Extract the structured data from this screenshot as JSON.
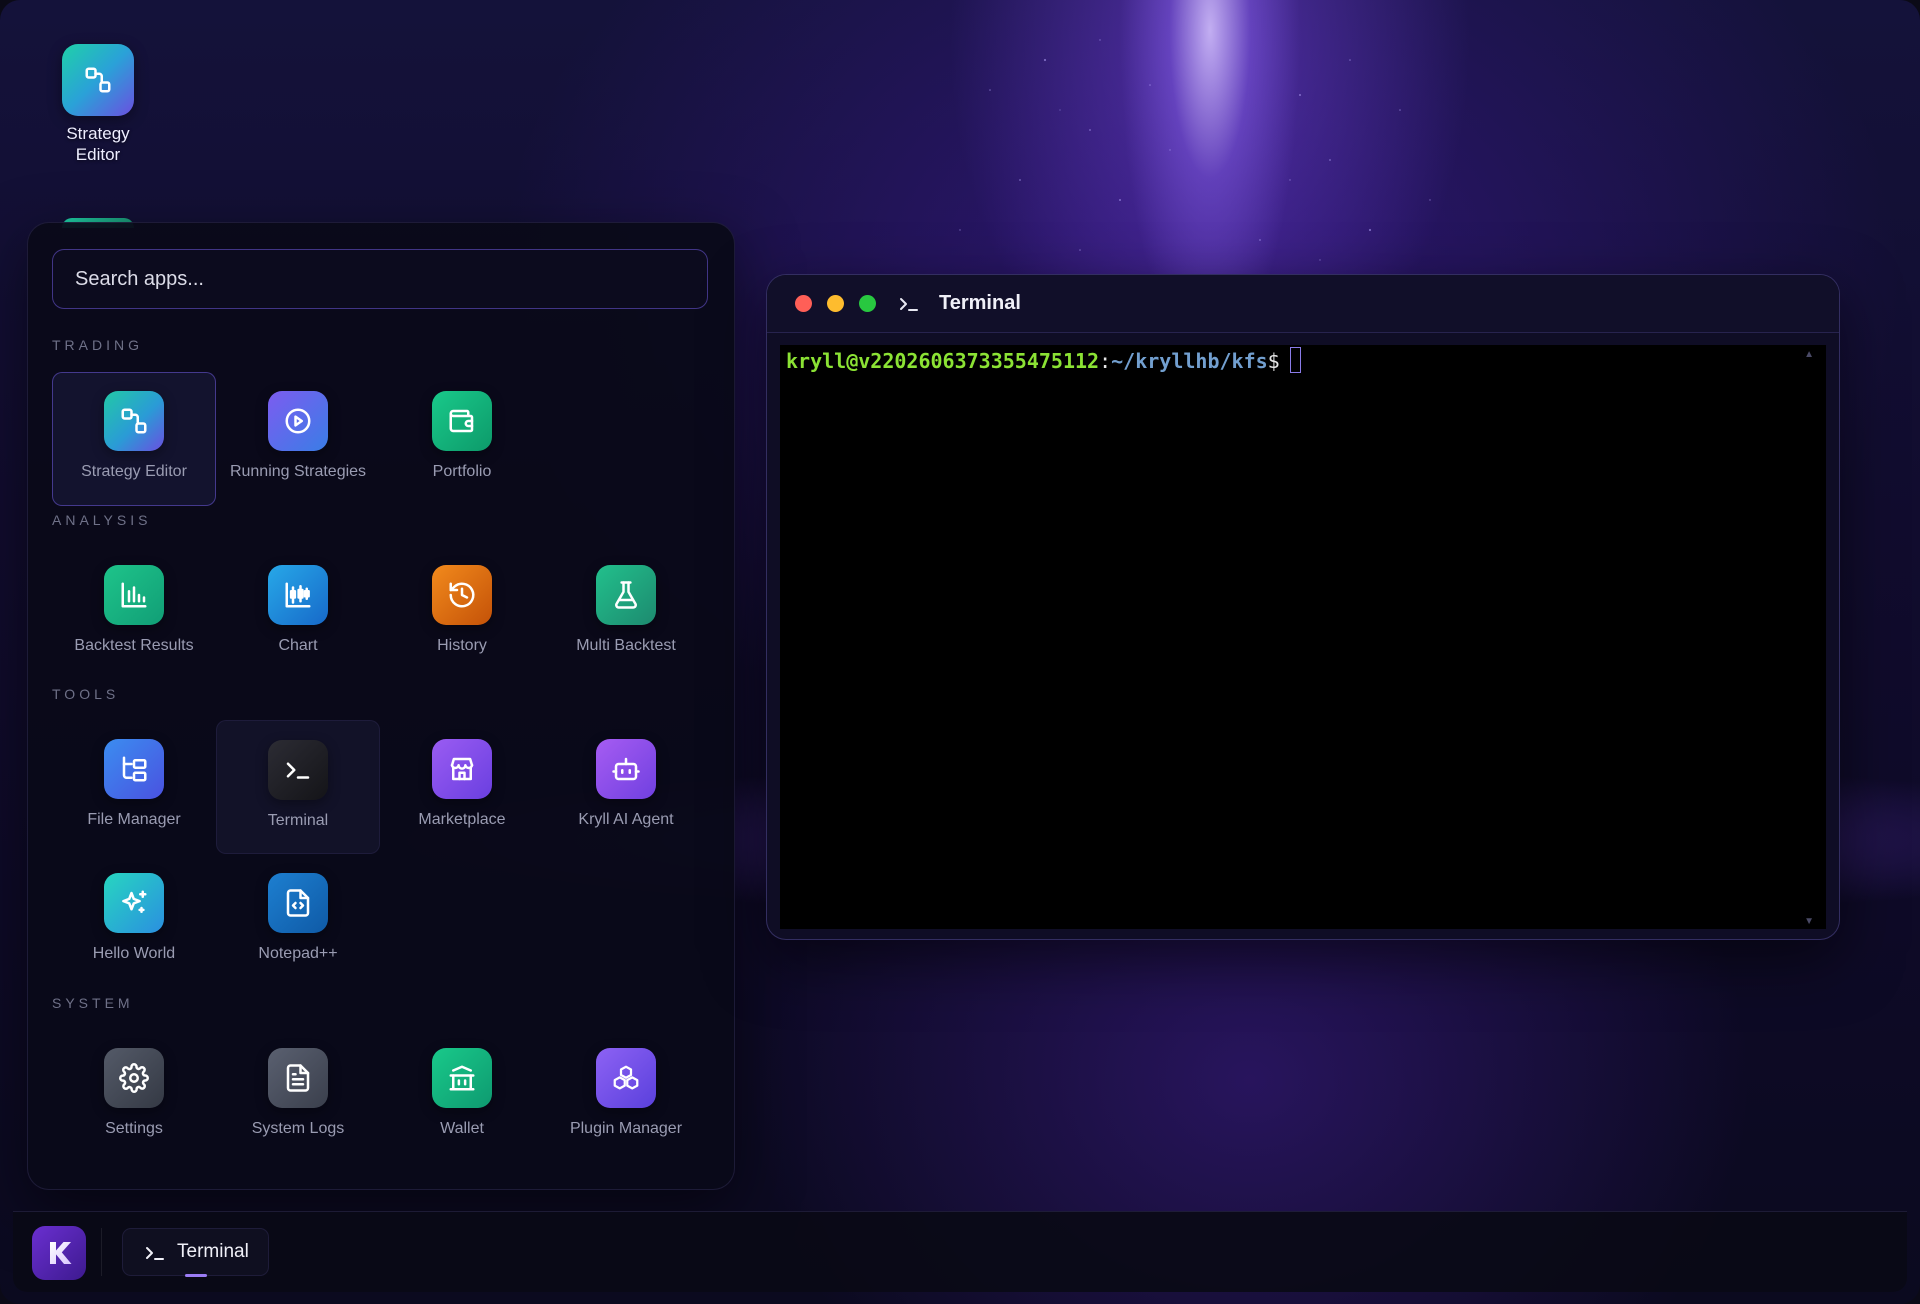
{
  "desktop": {
    "icons": [
      {
        "label": "Strategy Editor",
        "icon": "strategy-editor-icon"
      }
    ]
  },
  "launcher": {
    "search_placeholder": "Search apps...",
    "sections": [
      {
        "title": "TRADING",
        "apps": [
          {
            "name": "Strategy Editor",
            "icon": "nodes-icon",
            "selected": true
          },
          {
            "name": "Running Strategies",
            "icon": "play-circle-icon"
          },
          {
            "name": "Portfolio",
            "icon": "wallet-icon"
          }
        ]
      },
      {
        "title": "ANALYSIS",
        "apps": [
          {
            "name": "Backtest Results",
            "icon": "bar-chart-icon"
          },
          {
            "name": "Chart",
            "icon": "candlestick-icon"
          },
          {
            "name": "History",
            "icon": "history-icon"
          },
          {
            "name": "Multi Backtest",
            "icon": "flask-icon"
          }
        ]
      },
      {
        "title": "TOOLS",
        "apps": [
          {
            "name": "File Manager",
            "icon": "folder-tree-icon"
          },
          {
            "name": "Terminal",
            "icon": "terminal-icon",
            "hovered": true
          },
          {
            "name": "Marketplace",
            "icon": "store-icon"
          },
          {
            "name": "Kryll AI Agent",
            "icon": "robot-icon"
          },
          {
            "name": "Hello World",
            "icon": "sparkles-icon"
          },
          {
            "name": "Notepad++",
            "icon": "code-file-icon"
          }
        ]
      },
      {
        "title": "SYSTEM",
        "apps": [
          {
            "name": "Settings",
            "icon": "gear-icon"
          },
          {
            "name": "System Logs",
            "icon": "document-icon"
          },
          {
            "name": "Wallet",
            "icon": "bank-icon"
          },
          {
            "name": "Plugin Manager",
            "icon": "cubes-icon"
          }
        ]
      }
    ]
  },
  "terminal_window": {
    "title": "Terminal",
    "prompt_user_host": "kryll@v2202606373355475112",
    "prompt_colon": ":",
    "prompt_path": "~/kryllhb/kfs",
    "prompt_symbol": "$",
    "colors": {
      "close": "#ff5f57",
      "minimize": "#febc2e",
      "maximize": "#28c840",
      "user": "#8be234",
      "path": "#729fcf"
    }
  },
  "taskbar": {
    "launcher_logo": "K",
    "items": [
      {
        "label": "Terminal",
        "icon": "terminal-icon",
        "active": true
      }
    ]
  }
}
